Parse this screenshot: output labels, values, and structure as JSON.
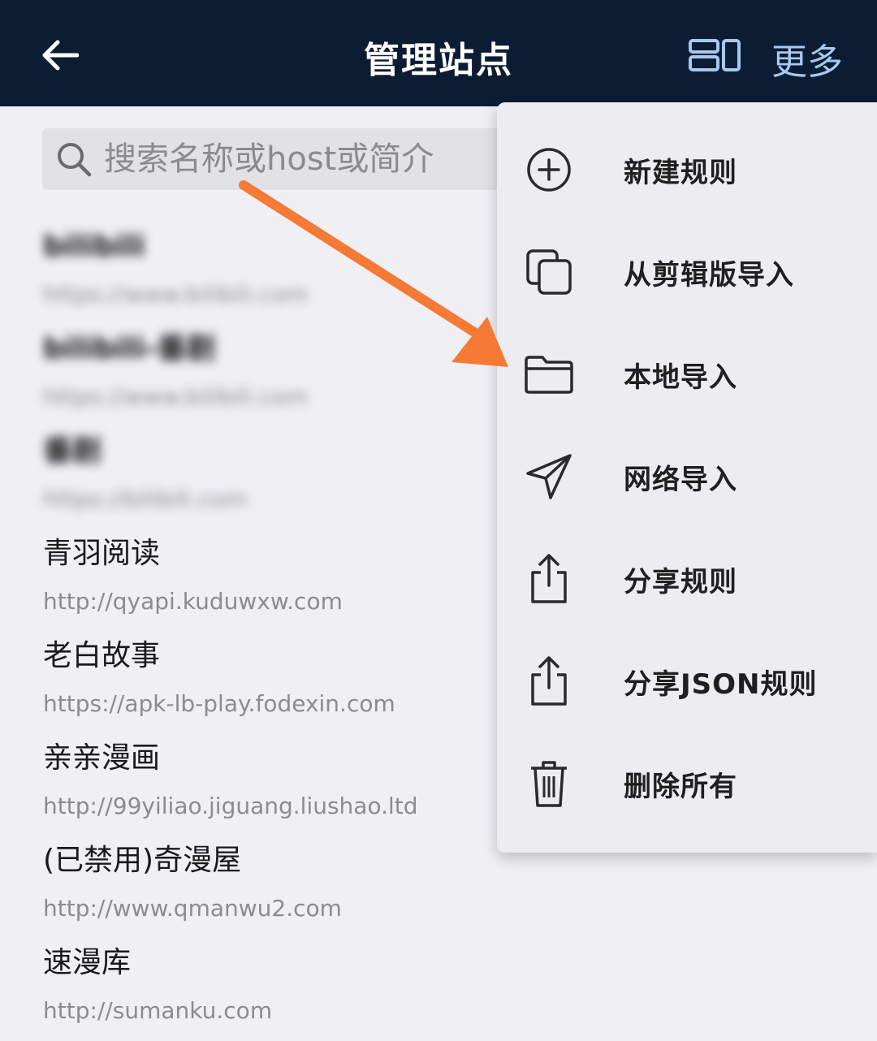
{
  "header": {
    "title": "管理站点",
    "back_icon": "arrow-left-icon",
    "layout_icon": "layout-toggle-icon",
    "more_label": "更多"
  },
  "search": {
    "placeholder": "搜索名称或host或简介",
    "icon": "search-icon"
  },
  "sites": [
    {
      "name": "bilibili",
      "url": "https://www.bilibili.com",
      "blurred": true
    },
    {
      "name": "bilibili-番剧",
      "url": "https://www.bilibili.com",
      "blurred": true
    },
    {
      "name": "番剧",
      "url": "https://bilibili.com",
      "blurred": true
    },
    {
      "name": "青羽阅读",
      "url": "http://qyapi.kuduwxw.com",
      "blurred": false
    },
    {
      "name": "老白故事",
      "url": "https://apk-lb-play.fodexin.com",
      "blurred": false
    },
    {
      "name": "亲亲漫画",
      "url": "http://99yiliao.jiguang.liushao.ltd",
      "blurred": false
    },
    {
      "name": "(已禁用)奇漫屋",
      "url": "http://www.qmanwu2.com",
      "blurred": false
    },
    {
      "name": "速漫库",
      "url": "http://sumanku.com",
      "blurred": false
    }
  ],
  "menu": {
    "items": [
      {
        "label": "新建规则",
        "icon": "plus-circle-icon"
      },
      {
        "label": "从剪辑版导入",
        "icon": "copy-icon"
      },
      {
        "label": "本地导入",
        "icon": "folder-icon"
      },
      {
        "label": "网络导入",
        "icon": "send-icon"
      },
      {
        "label": "分享规则",
        "icon": "share-icon"
      },
      {
        "label": "分享JSON规则",
        "icon": "share-icon"
      },
      {
        "label": "删除所有",
        "icon": "trash-icon"
      }
    ]
  },
  "colors": {
    "header_bg": "#0c1c33",
    "more_text": "#a8c8f0",
    "page_bg": "#efeff4",
    "menu_bg": "#ececf1",
    "annotation_arrow": "#f57a36"
  }
}
